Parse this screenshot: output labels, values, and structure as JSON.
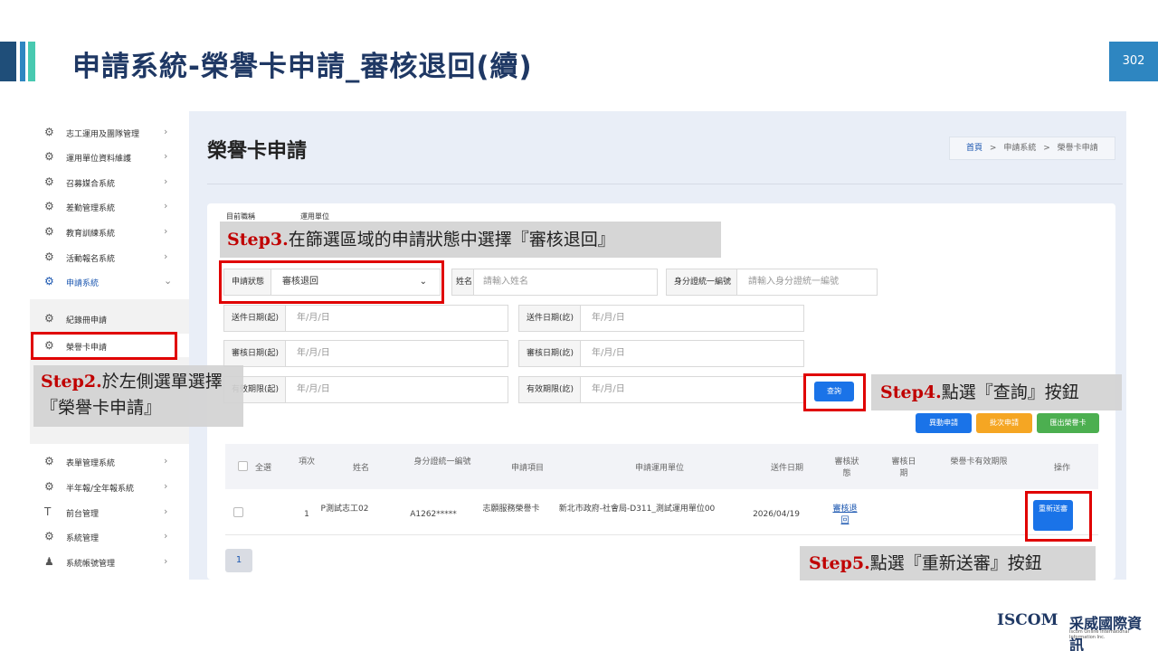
{
  "slide": {
    "title": "申請系統-榮譽卡申請_審核退回(續)",
    "page_number": "302"
  },
  "sidebar": {
    "items": [
      {
        "label": "志工運用及團隊管理",
        "chev": "›"
      },
      {
        "label": "運用單位資料維護",
        "chev": "›"
      },
      {
        "label": "召募媒合系統",
        "chev": "›"
      },
      {
        "label": "差勤管理系統",
        "chev": "›"
      },
      {
        "label": "教育訓練系統",
        "chev": "›"
      },
      {
        "label": "活動報名系統",
        "chev": "›"
      },
      {
        "label": "申請系統",
        "chev": "⌄"
      }
    ],
    "sub_items": [
      {
        "label": "紀錄冊申請"
      },
      {
        "label": "榮譽卡申請"
      }
    ],
    "lower_items": [
      {
        "label": "表單管理系統",
        "chev": "›"
      },
      {
        "label": "半年報/全年報系統",
        "chev": "›"
      },
      {
        "label": "前台管理",
        "chev": "›"
      },
      {
        "label": "系統管理",
        "chev": "›"
      },
      {
        "label": "系統帳號管理",
        "chev": "›"
      }
    ]
  },
  "main": {
    "page_title": "榮譽卡申請",
    "breadcrumb": {
      "home": "首頁",
      "sep": ">",
      "mid": "申請系統",
      "current": "榮譽卡申請"
    },
    "filters": {
      "label_org": "目前職稱",
      "label_unit": "運用單位",
      "status_label": "申請狀態",
      "status_value": "審核退回",
      "name_label": "姓名",
      "name_placeholder": "請輸入姓名",
      "id_label": "身分證統一編號",
      "id_placeholder": "請輸入身分證統一編號",
      "send_start_label": "送件日期(起)",
      "send_end_label": "送件日期(訖)",
      "review_start_label": "審核日期(起)",
      "review_end_label": "審核日期(訖)",
      "valid_start_label": "有效期限(起)",
      "valid_end_label": "有效期限(訖)",
      "date_placeholder": "年/月/日",
      "query_button": "查詢"
    },
    "actions": {
      "bulk_apply": "異動申請",
      "batch_apply": "批次申請",
      "export": "匯出榮譽卡"
    },
    "table": {
      "headers": [
        "全選",
        "項次",
        "姓名",
        "身分證統一編號",
        "申請項目",
        "申請運用單位",
        "送件日期",
        "審核狀態",
        "審核日期",
        "榮譽卡有效期限",
        "操作"
      ],
      "rows": [
        {
          "index": "1",
          "name": "P測試志工02",
          "id": "A1262*****",
          "item": "志願服務榮譽卡",
          "unit": "新北市政府-社會局-D311_測試運用單位00",
          "send_date": "2026/04/19",
          "status": "審核退回",
          "review_date": "",
          "valid_until": "",
          "action": "重新送審"
        }
      ]
    },
    "pagination": {
      "current": "1"
    }
  },
  "annotations": {
    "step2": {
      "step": "Step2.",
      "text": "於左側選單選擇『榮譽卡申請』"
    },
    "step3": {
      "step": "Step3.",
      "text": "在篩選區域的申請狀態中選擇『審核退回』"
    },
    "step4": {
      "step": "Step4.",
      "text": "點選『查詢』按鈕"
    },
    "step5": {
      "step": "Step5.",
      "text": "點選『重新送審』按鈕"
    }
  },
  "logo": {
    "brand": "ISCOM",
    "company": "采威國際資訊",
    "tagline": "Iscom Online International Information Inc."
  },
  "colors": {
    "title": "#1f3864",
    "accent": "#2e86c1",
    "highlight_red": "#e00000",
    "step_red": "#c00000",
    "primary_button": "#1a73e8"
  }
}
